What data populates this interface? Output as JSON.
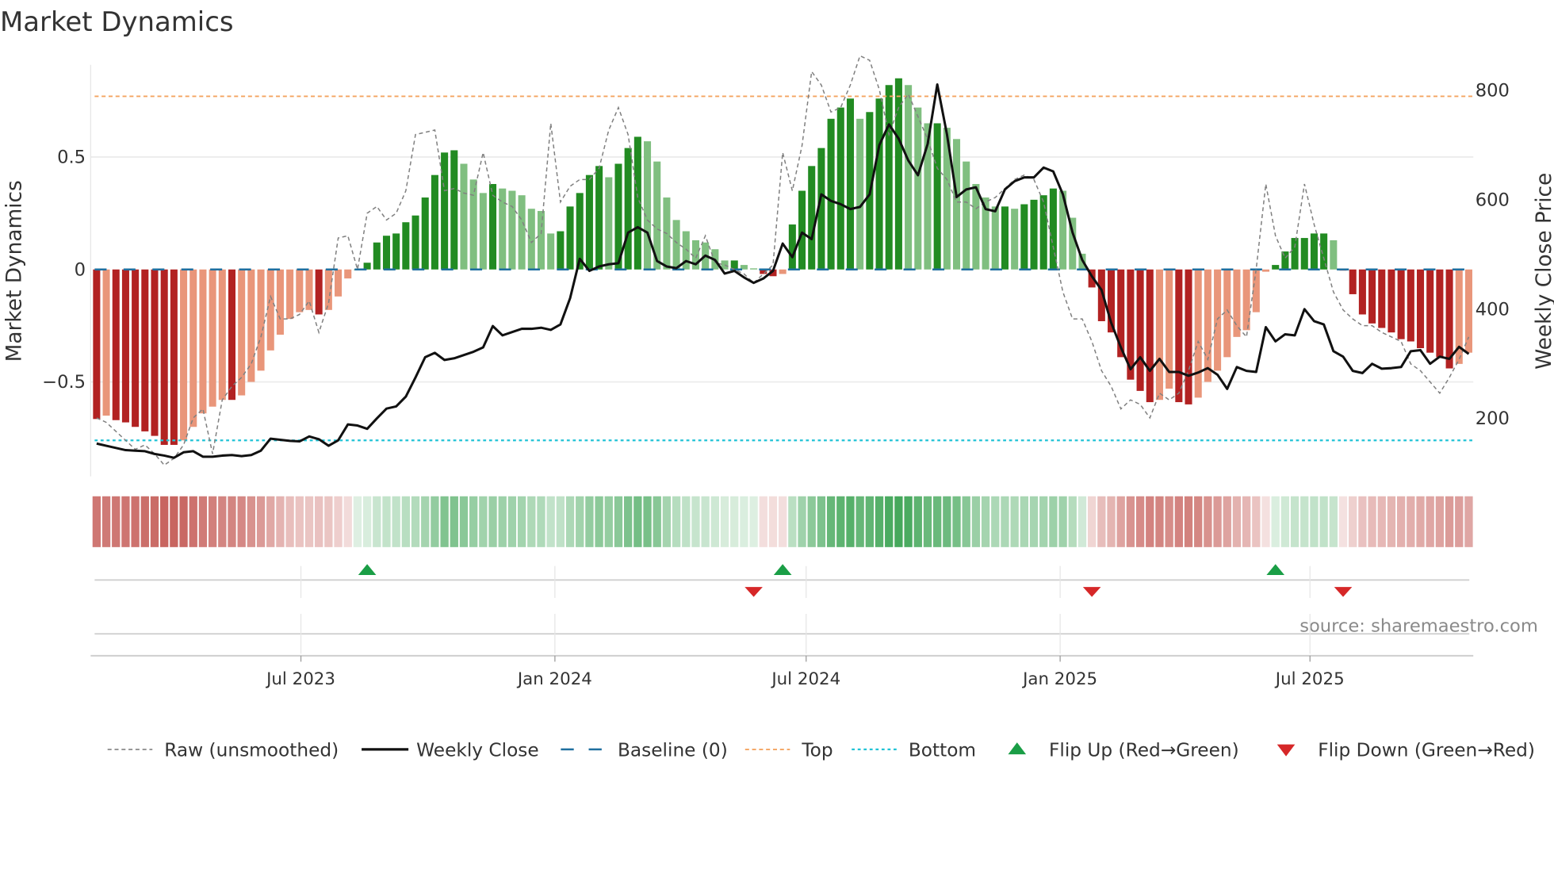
{
  "chart_data": {
    "type": "bar",
    "title": "Market Dynamics",
    "ylabel": "Market Dynamics",
    "y2label": "Weekly Close Price",
    "source": "source: sharemaestro.com",
    "start_date": "2023-02-03",
    "frequency_days": 7,
    "ylim": [
      -0.92,
      0.91
    ],
    "y2lim": [
      94,
      847
    ],
    "yticks": [
      {
        "v": 0.5,
        "label": "0.5"
      },
      {
        "v": 0,
        "label": "0"
      },
      {
        "v": -0.5,
        "label": "−0.5"
      }
    ],
    "y2ticks": [
      {
        "v": 800,
        "label": "800"
      },
      {
        "v": 600,
        "label": "600"
      },
      {
        "v": 400,
        "label": "400"
      },
      {
        "v": 200,
        "label": "200"
      }
    ],
    "xticks": [
      {
        "date": "2023-07-01",
        "label": "Jul 2023"
      },
      {
        "date": "2024-01-01",
        "label": "Jan 2024"
      },
      {
        "date": "2024-07-01",
        "label": "Jul 2024"
      },
      {
        "date": "2025-01-01",
        "label": "Jan 2025"
      },
      {
        "date": "2025-07-01",
        "label": "Jul 2025"
      }
    ],
    "top": 0.77,
    "bottom": -0.76,
    "baseline": 0,
    "smoothed": [
      -0.665,
      -0.65,
      -0.67,
      -0.68,
      -0.7,
      -0.72,
      -0.74,
      -0.78,
      -0.78,
      -0.76,
      -0.7,
      -0.64,
      -0.61,
      -0.58,
      -0.58,
      -0.56,
      -0.5,
      -0.45,
      -0.36,
      -0.29,
      -0.22,
      -0.19,
      -0.18,
      -0.2,
      -0.18,
      -0.12,
      -0.04,
      0.0,
      0.03,
      0.12,
      0.15,
      0.16,
      0.21,
      0.24,
      0.32,
      0.42,
      0.52,
      0.53,
      0.47,
      0.4,
      0.34,
      0.38,
      0.36,
      0.35,
      0.33,
      0.27,
      0.26,
      0.16,
      0.17,
      0.28,
      0.34,
      0.42,
      0.46,
      0.41,
      0.47,
      0.54,
      0.59,
      0.57,
      0.48,
      0.32,
      0.22,
      0.17,
      0.13,
      0.12,
      0.09,
      0.04,
      0.04,
      0.02,
      0.005,
      -0.02,
      -0.03,
      -0.02,
      0.2,
      0.35,
      0.46,
      0.54,
      0.67,
      0.72,
      0.76,
      0.67,
      0.7,
      0.76,
      0.82,
      0.85,
      0.82,
      0.72,
      0.65,
      0.65,
      0.63,
      0.58,
      0.48,
      0.38,
      0.32,
      0.28,
      0.28,
      0.27,
      0.29,
      0.31,
      0.33,
      0.36,
      0.35,
      0.23,
      0.07,
      -0.08,
      -0.23,
      -0.28,
      -0.39,
      -0.49,
      -0.54,
      -0.59,
      -0.58,
      -0.53,
      -0.59,
      -0.6,
      -0.57,
      -0.5,
      -0.45,
      -0.39,
      -0.3,
      -0.27,
      -0.19,
      -0.01,
      0.02,
      0.08,
      0.14,
      0.14,
      0.16,
      0.16,
      0.13,
      -0.005,
      -0.11,
      -0.2,
      -0.24,
      -0.26,
      -0.28,
      -0.31,
      -0.32,
      -0.35,
      -0.37,
      -0.39,
      -0.44,
      -0.42,
      -0.37
    ],
    "raw": [
      -0.66,
      -0.68,
      -0.72,
      -0.76,
      -0.8,
      -0.78,
      -0.82,
      -0.87,
      -0.84,
      -0.78,
      -0.66,
      -0.62,
      -0.82,
      -0.58,
      -0.52,
      -0.48,
      -0.42,
      -0.3,
      -0.12,
      -0.22,
      -0.22,
      -0.2,
      -0.14,
      -0.28,
      -0.15,
      0.14,
      0.15,
      0.0,
      0.25,
      0.28,
      0.22,
      0.25,
      0.35,
      0.6,
      0.61,
      0.62,
      0.35,
      0.36,
      0.34,
      0.33,
      0.52,
      0.33,
      0.3,
      0.28,
      0.22,
      0.12,
      0.16,
      0.65,
      0.3,
      0.37,
      0.4,
      0.4,
      0.45,
      0.62,
      0.72,
      0.6,
      0.32,
      0.22,
      0.18,
      0.16,
      0.12,
      0.09,
      0.05,
      0.15,
      0.03,
      0.02,
      0.0,
      -0.02,
      -0.06,
      -0.02,
      0.02,
      0.52,
      0.35,
      0.55,
      0.88,
      0.82,
      0.7,
      0.72,
      0.82,
      0.95,
      0.93,
      0.8,
      0.6,
      0.72,
      0.78,
      0.68,
      0.58,
      0.45,
      0.4,
      0.3,
      0.3,
      0.27,
      0.3,
      0.32,
      0.36,
      0.4,
      0.42,
      0.4,
      0.3,
      0.1,
      -0.1,
      -0.22,
      -0.22,
      -0.32,
      -0.45,
      -0.52,
      -0.62,
      -0.58,
      -0.6,
      -0.66,
      -0.55,
      -0.58,
      -0.55,
      -0.45,
      -0.32,
      -0.4,
      -0.22,
      -0.18,
      -0.25,
      -0.3,
      0.0,
      0.38,
      0.15,
      0.05,
      0.1,
      0.38,
      0.2,
      0.05,
      -0.1,
      -0.18,
      -0.22,
      -0.25,
      -0.25,
      -0.28,
      -0.3,
      -0.32,
      -0.42,
      -0.45,
      -0.5,
      -0.55,
      -0.48,
      -0.4,
      -0.3
    ],
    "close": [
      154,
      150,
      146,
      142,
      141,
      140,
      135,
      132,
      128,
      138,
      140,
      130,
      130,
      132,
      133,
      131,
      133,
      141,
      163,
      161,
      159,
      158,
      167,
      162,
      150,
      160,
      189,
      187,
      181,
      200,
      218,
      222,
      240,
      275,
      312,
      320,
      307,
      310,
      316,
      322,
      330,
      369,
      352,
      358,
      364,
      364,
      366,
      362,
      372,
      420,
      492,
      470,
      478,
      482,
      484,
      540,
      550,
      540,
      488,
      478,
      475,
      488,
      482,
      498,
      490,
      465,
      470,
      458,
      448,
      456,
      470,
      520,
      495,
      540,
      528,
      610,
      598,
      592,
      583,
      587,
      610,
      700,
      738,
      712,
      672,
      645,
      702,
      811,
      720,
      605,
      619,
      623,
      583,
      579,
      619,
      634,
      641,
      641,
      659,
      652,
      610,
      540,
      490,
      460,
      435,
      375,
      330,
      290,
      312,
      287,
      309,
      285,
      285,
      278,
      284,
      292,
      280,
      254,
      294,
      287,
      285,
      367,
      341,
      354,
      352,
      400,
      378,
      372,
      323,
      313,
      287,
      283,
      300,
      291,
      292,
      294,
      323,
      325,
      300,
      313,
      309,
      331,
      318
    ],
    "flips_up": [
      "2023-08-18",
      "2024-06-14",
      "2025-06-06"
    ],
    "flips_down": [
      "2024-05-24",
      "2025-01-24",
      "2025-07-25"
    ],
    "legend": [
      {
        "key": "raw",
        "label": "Raw (unsmoothed)"
      },
      {
        "key": "close",
        "label": "Weekly Close"
      },
      {
        "key": "baseline",
        "label": "Baseline (0)"
      },
      {
        "key": "top",
        "label": "Top"
      },
      {
        "key": "bottom",
        "label": "Bottom"
      },
      {
        "key": "flip_up",
        "label": "Flip Up (Red→Green)"
      },
      {
        "key": "flip_down",
        "label": "Flip Down (Green→Red)"
      }
    ],
    "colors": {
      "up_strong": "#228b22",
      "up_weak": "#80bf80",
      "down_strong": "#b22222",
      "down_weak": "#e9967a",
      "close": "#111111",
      "raw": "#808080",
      "baseline": "#1f6f9f",
      "top": "#f4a460",
      "bottom": "#22c3d6",
      "flip_up": "#1a9e46",
      "flip_down": "#d62728"
    }
  }
}
